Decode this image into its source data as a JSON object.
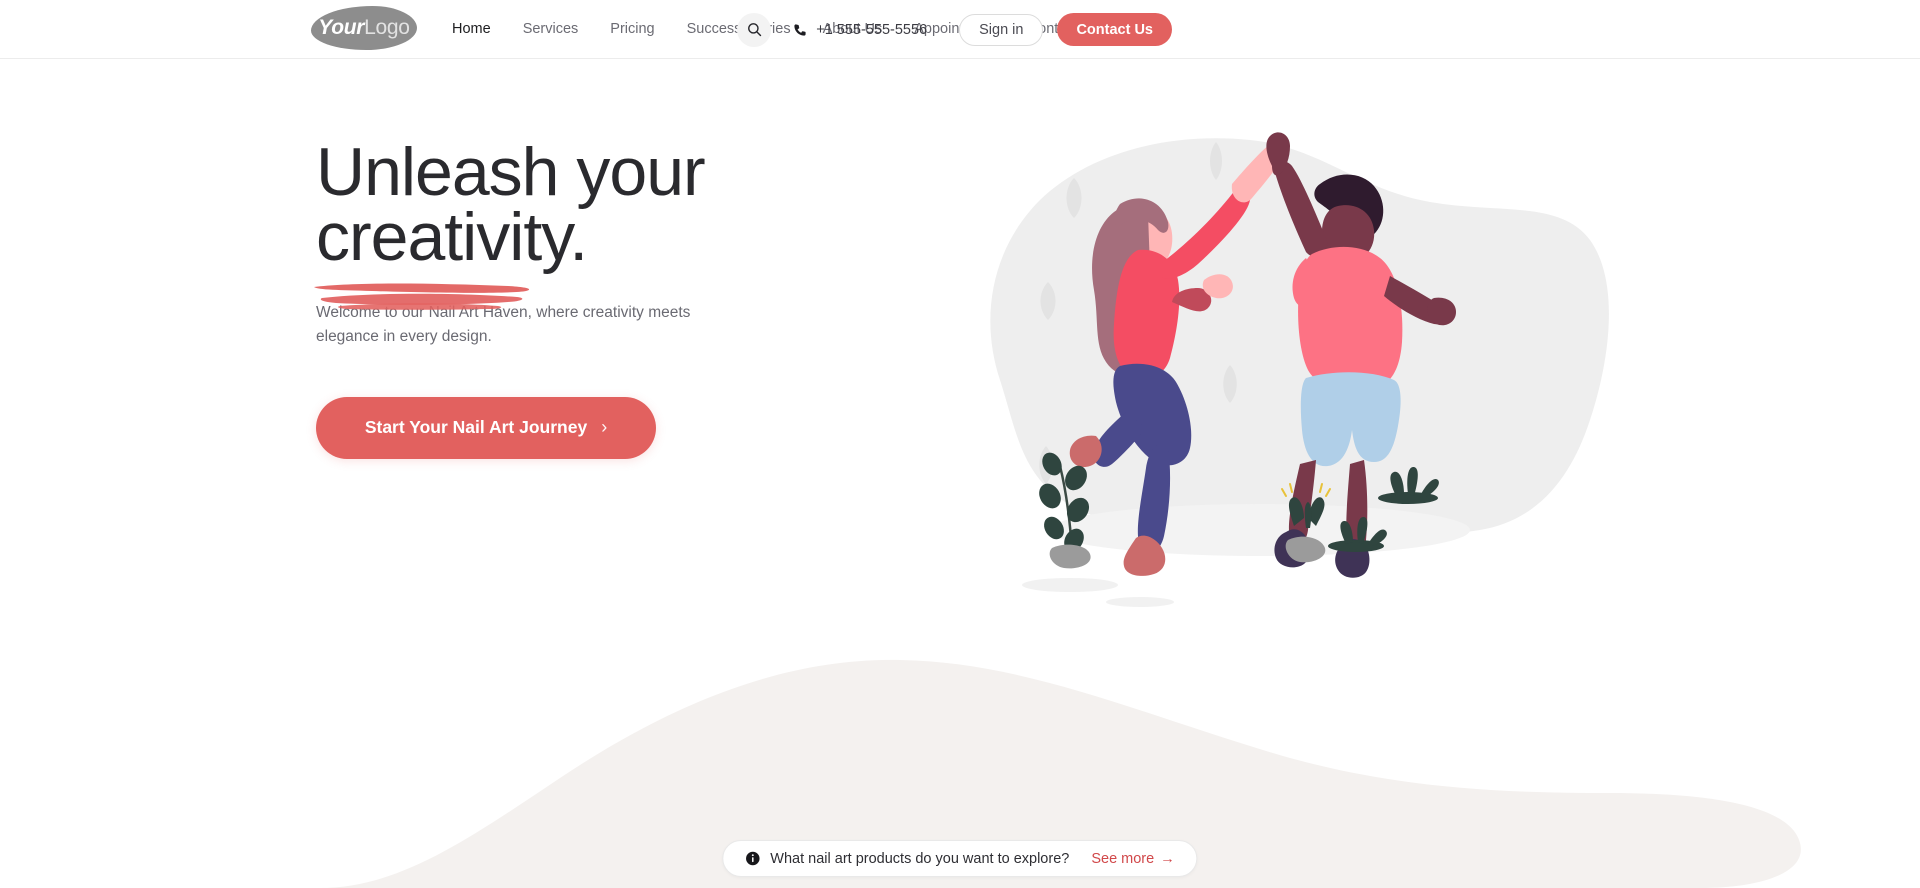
{
  "brand": {
    "logo_primary": "Your",
    "logo_secondary": "Logo",
    "accent_color": "#e2615f",
    "link_red": "#d1484a"
  },
  "nav": {
    "items": [
      {
        "label": "Home",
        "active": true
      },
      {
        "label": "Services",
        "active": false
      },
      {
        "label": "Pricing",
        "active": false
      },
      {
        "label": "Success Stories",
        "active": false
      },
      {
        "label": "About Us",
        "active": false
      },
      {
        "label": "Appointment",
        "active": false
      },
      {
        "label": "Contact us",
        "active": false
      }
    ],
    "search_icon": "search-icon",
    "phone_icon": "phone-icon",
    "phone": "+1 555-555-5556",
    "signin_label": "Sign in",
    "contact_label": "Contact Us"
  },
  "hero": {
    "title_line1": "Unleash your",
    "title_line2": "creativity.",
    "subtitle": "Welcome to our Nail Art Haven, where creativity meets elegance in every design.",
    "cta_label": "Start Your Nail Art Journey",
    "cta_chevron": "›",
    "illustration": "two-people-high-five-illustration"
  },
  "bottom_bar": {
    "info_icon": "info-icon",
    "question": "What nail art products do you want to explore?",
    "link_label": "See more",
    "link_arrow": "→"
  }
}
